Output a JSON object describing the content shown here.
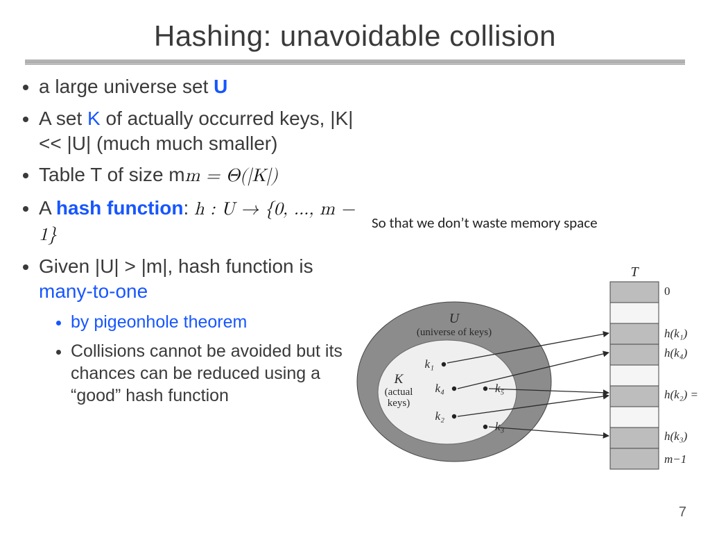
{
  "title": "Hashing: unavoidable collision",
  "bullets": {
    "b1_pre": "a large universe set ",
    "b1_U": "U",
    "b2_pre": "A set ",
    "b2_K": "K",
    "b2_post": " of actually occurred keys, |K| << |U| (much much smaller)",
    "b3_pre": "Table T of size m",
    "b3_math": "m = Θ(|K|)",
    "b4_pre": "A ",
    "b4_hf": "hash function",
    "b4_post": ": ",
    "b4_math": "h : U → {0, ..., m − 1}",
    "b5_pre": "Given |U| > |m|, hash function is ",
    "b5_mto": "many-to-one",
    "sb1": "by pigeonhole theorem",
    "sb2": "Collisions cannot be avoided but its chances can be reduced using a “good” hash function"
  },
  "annotation": "So that we don’t waste memory space",
  "diagram": {
    "U_label1": "U",
    "U_label2": "(universe of keys)",
    "K_label1": "K",
    "K_label2": "(actual",
    "K_label3": "keys)",
    "k1": "k₁",
    "k2": "k₂",
    "k3": "k₃",
    "k4": "k₄",
    "k5": "k₅",
    "T": "T",
    "slot0": "0",
    "hk1": "h(k₁)",
    "hk4": "h(k₄)",
    "hk2": "h(k₂) =",
    "hk3": "h(k₃)",
    "mlast": "m−1"
  },
  "page": "7"
}
